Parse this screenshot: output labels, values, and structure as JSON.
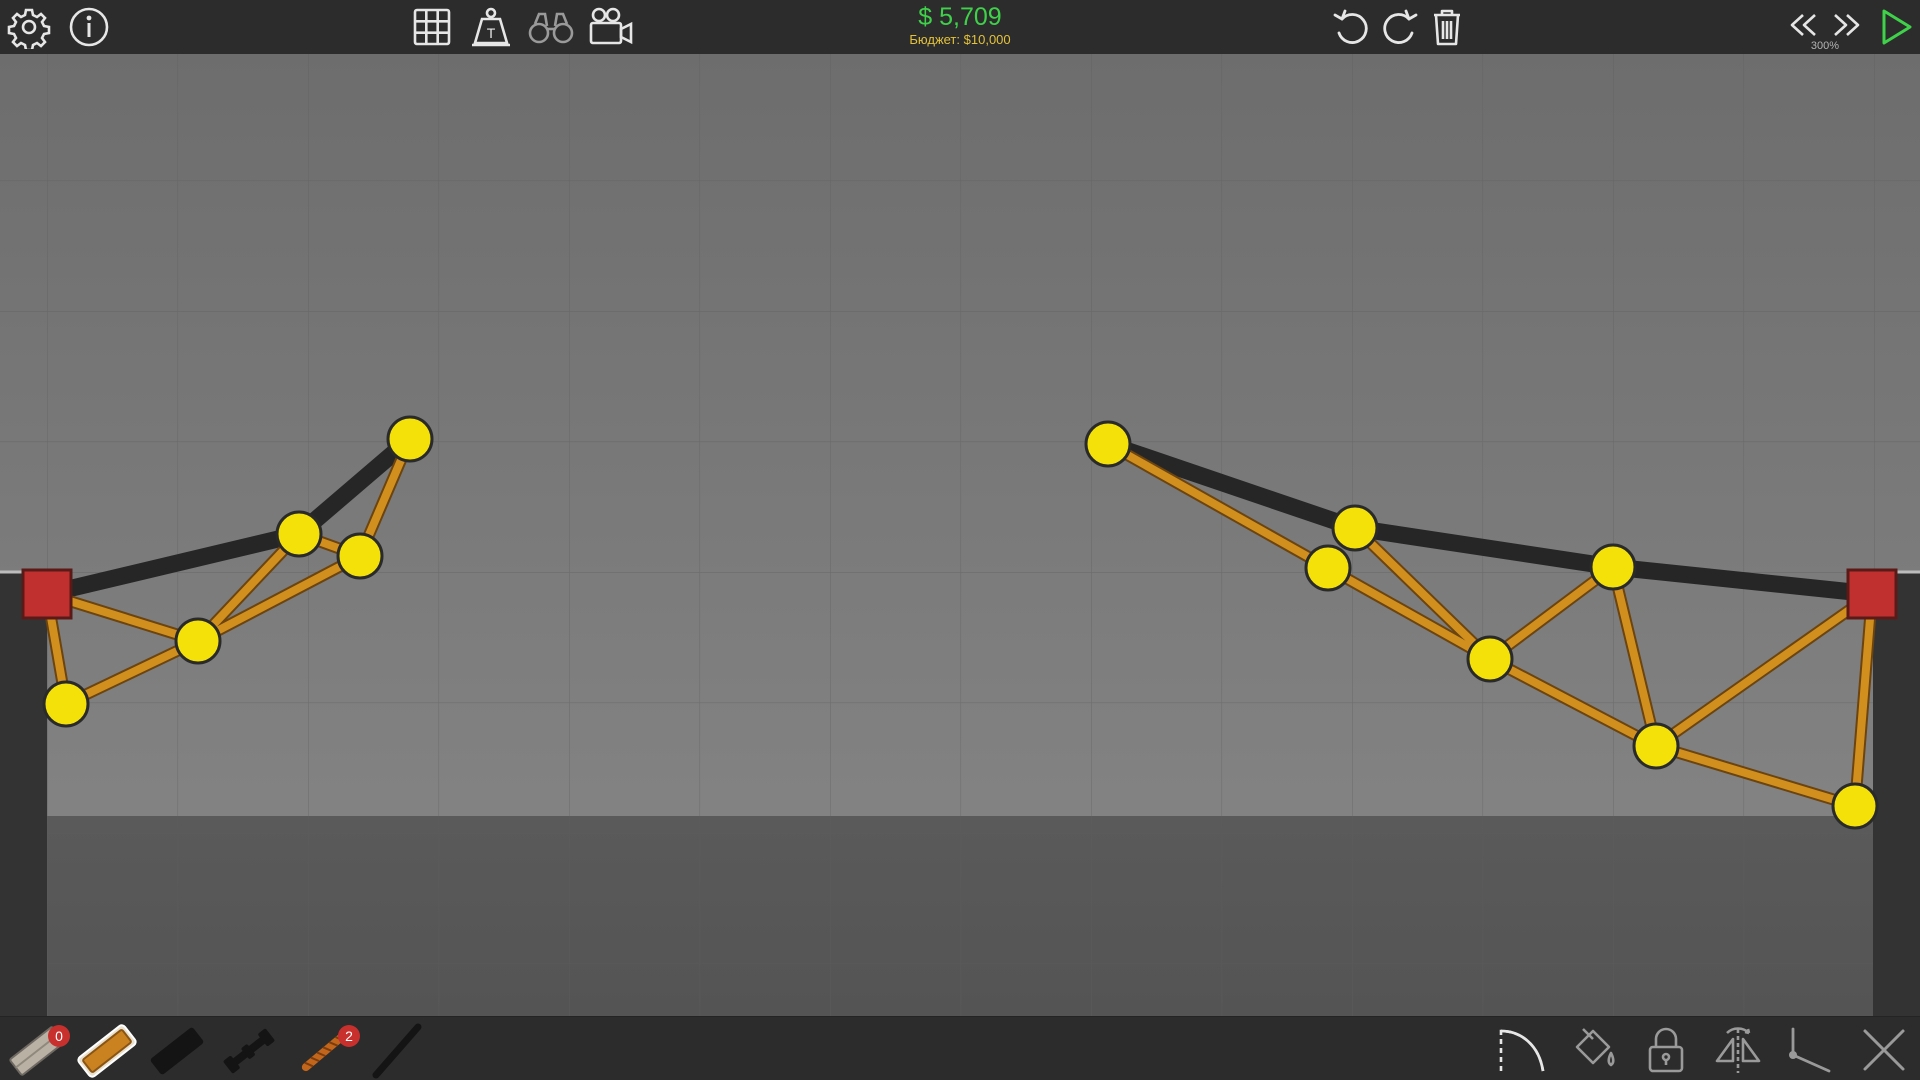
{
  "header": {
    "cost": "$ 5,709",
    "budget_label": "Бюджет:",
    "budget_value": "$10,000",
    "speed": "300%"
  },
  "toolbar_left": [
    "settings-icon",
    "info-icon"
  ],
  "toolbar_center": [
    "grid-icon",
    "weight-icon",
    "binoculars-icon",
    "camera-icon"
  ],
  "toolbar_right": [
    "undo-icon",
    "redo-icon",
    "trash-icon"
  ],
  "playback": [
    "rewind-icon",
    "fast-forward-icon",
    "play-icon"
  ],
  "materials": [
    {
      "name": "road",
      "count": "0"
    },
    {
      "name": "reinforced-road",
      "count": ""
    },
    {
      "name": "wood-selected",
      "count": ""
    },
    {
      "name": "steel",
      "count": ""
    },
    {
      "name": "hydraulic",
      "count": ""
    },
    {
      "name": "rope",
      "count": "2"
    },
    {
      "name": "cable",
      "count": ""
    }
  ],
  "bottom_tools": [
    "draw-curve-icon",
    "paint-bucket-icon",
    "lock-icon",
    "mirror-icon",
    "split-joint-icon",
    "close-icon"
  ],
  "colors": {
    "cost": "#3fd14a",
    "budget": "#e3c23a",
    "wood_beam": "#c98a1c",
    "road_beam": "#262626",
    "joint": "#f5e10a",
    "anchor": "#c0302e",
    "badge": "#c8302e"
  }
}
